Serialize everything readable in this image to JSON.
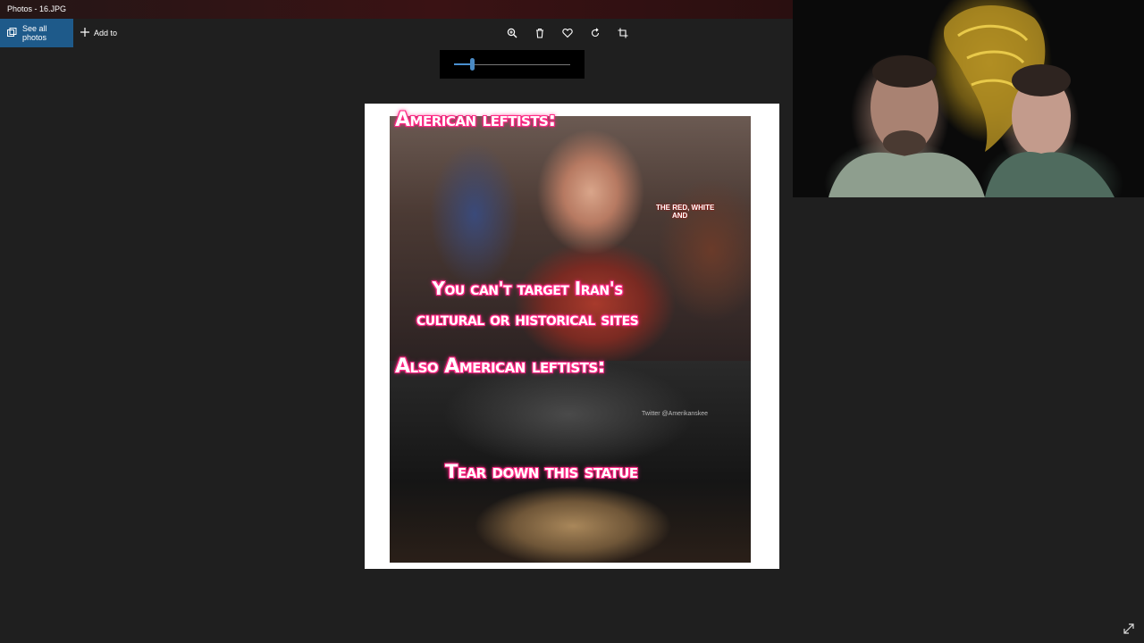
{
  "window": {
    "title": "Photos - 16.JPG"
  },
  "toolbar": {
    "see_all_photos": "See all photos",
    "add_to": "Add to",
    "tools": [
      {
        "icon": "zoom-icon"
      },
      {
        "icon": "delete-icon"
      },
      {
        "icon": "favorite-icon"
      },
      {
        "icon": "rotate-icon"
      },
      {
        "icon": "crop-icon"
      }
    ]
  },
  "zoom": {
    "level_fraction": 0.16
  },
  "meme": {
    "heading_1": "American leftists:",
    "quote_1_line1": "You can't target Iran's",
    "quote_1_line2": "cultural or historical sites",
    "heading_2": "Also American leftists:",
    "quote_2": "Tear down this statue",
    "watermark_line1": "THE RED, WHITE",
    "watermark_line2": "AND",
    "credit": "Twitter @Amerikanskee"
  },
  "colors": {
    "accent": "#1e5a8a",
    "meme_glow": "#ff2a86"
  },
  "expand_icon": "expand-icon"
}
